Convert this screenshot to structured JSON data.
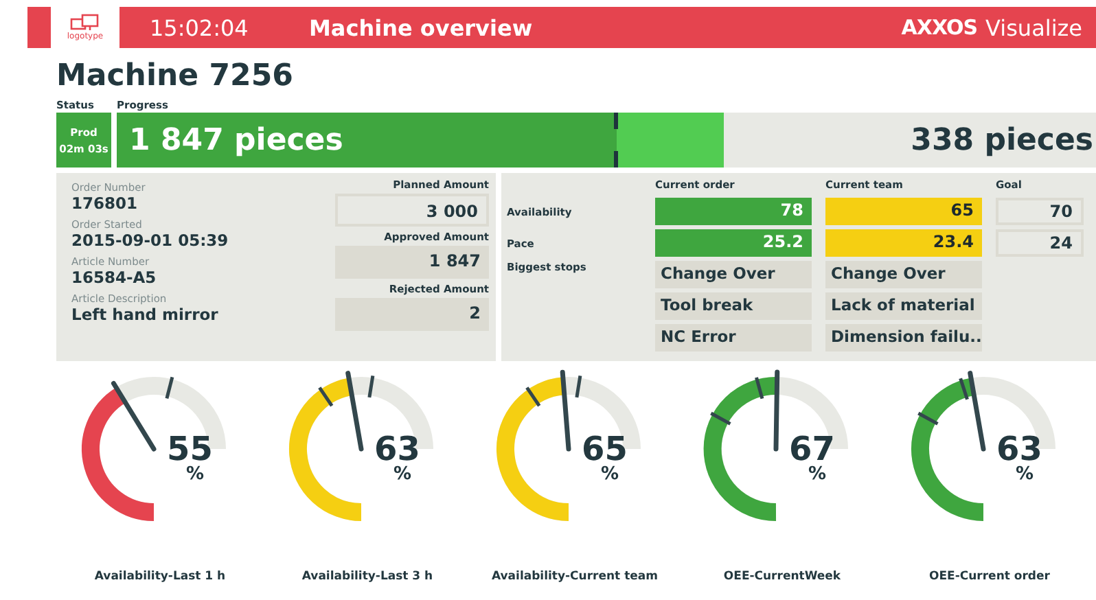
{
  "header": {
    "time": "15:02:04",
    "title": "Machine overview",
    "brand": "AXXOS",
    "product": "Visualize",
    "logo_text": "logotype"
  },
  "machine_title": "Machine 7256",
  "status": {
    "label": "Status",
    "state": "Prod",
    "duration": "02m 03s",
    "color": "#3fa63f"
  },
  "progress": {
    "label": "Progress",
    "produced": "1 847 pieces",
    "remaining": "338 pieces",
    "level": 0.62,
    "expected": {
      "level": 0.51
    }
  },
  "order_fields": [
    {
      "label": "Order Number",
      "value": "176801"
    },
    {
      "label": "Order Started",
      "value": "2015-09-01 05:39"
    },
    {
      "label": "Article Number",
      "value": "16584-A5"
    },
    {
      "label": "Article Description",
      "value": "Left hand mirror"
    }
  ],
  "amounts": [
    {
      "label": "Planned Amount",
      "value": "3 000",
      "kind": "outlined"
    },
    {
      "label": "Approved Amount",
      "value": "1 847",
      "kind": "filled"
    },
    {
      "label": "Rejected Amount",
      "value": "2",
      "kind": "filled"
    }
  ],
  "kpi_columns": [
    "Current order",
    "Current team",
    "Goal"
  ],
  "kpi_rows": [
    {
      "label": "Availability",
      "current_order": {
        "value": "78",
        "color": "#3fa63f"
      },
      "current_team": {
        "value": "65",
        "color": "#f5cf12"
      },
      "goal": "70"
    },
    {
      "label": "Pace",
      "current_order": {
        "value": "25.2",
        "color": "#3fa63f"
      },
      "current_team": {
        "value": "23.4",
        "color": "#f5cf12"
      },
      "goal": "24"
    }
  ],
  "stops": {
    "label": "Biggest stops",
    "current_order": [
      "Change Over",
      "Tool break",
      "NC Error"
    ],
    "current_team": [
      "Change Over",
      "Lack of material",
      "Dimension failu.."
    ]
  },
  "gauges": [
    {
      "value": "55",
      "unit": "%",
      "label": "Availability-Last 1 h",
      "color": "#e5444f"
    },
    {
      "value": "63",
      "unit": "%",
      "label": "Availability-Last 3 h",
      "color": "#f5cf12"
    },
    {
      "value": "65",
      "unit": "%",
      "label": "Availability-Current team",
      "color": "#f5cf12"
    },
    {
      "value": "67",
      "unit": "%",
      "label": "OEE-CurrentWeek",
      "color": "#3fa63f"
    },
    {
      "value": "63",
      "unit": "%",
      "label": "OEE-Current order",
      "color": "#3fa63f"
    }
  ]
}
